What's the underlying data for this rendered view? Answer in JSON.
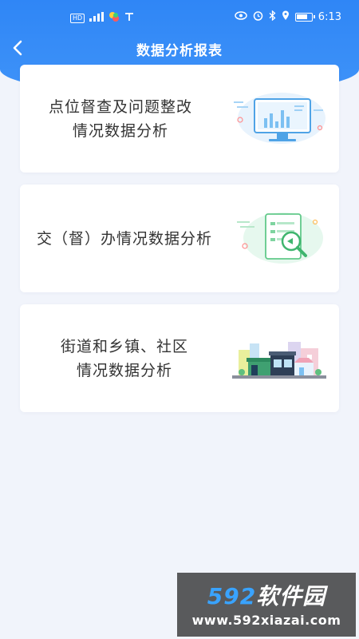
{
  "status_bar": {
    "left_icons": [
      "hd-icon",
      "signal-icon",
      "app-icon",
      "wifi-antenna-icon"
    ],
    "right_icons": [
      "eye-icon",
      "alarm-icon",
      "bluetooth-icon",
      "location-icon",
      "battery-icon"
    ],
    "hd_label": "HD",
    "time": "6:13"
  },
  "header": {
    "title": "数据分析报表",
    "back_icon": "chevron-left-icon"
  },
  "cards": [
    {
      "line1": "点位督查及问题整改",
      "line2": "情况数据分析",
      "illustration": "monitor-chart-icon"
    },
    {
      "line1": "交（督）办情况数据分析",
      "line2": "",
      "illustration": "document-magnifier-icon"
    },
    {
      "line1": "街道和乡镇、社区",
      "line2": "情况数据分析",
      "illustration": "town-street-icon"
    }
  ],
  "watermark": {
    "brand_num": "592",
    "brand_cn": "软件园",
    "url": "www.592xiazai.com"
  },
  "colors": {
    "header_blue": "#2f86f6",
    "background": "#f1f4fb",
    "text": "#333333"
  }
}
